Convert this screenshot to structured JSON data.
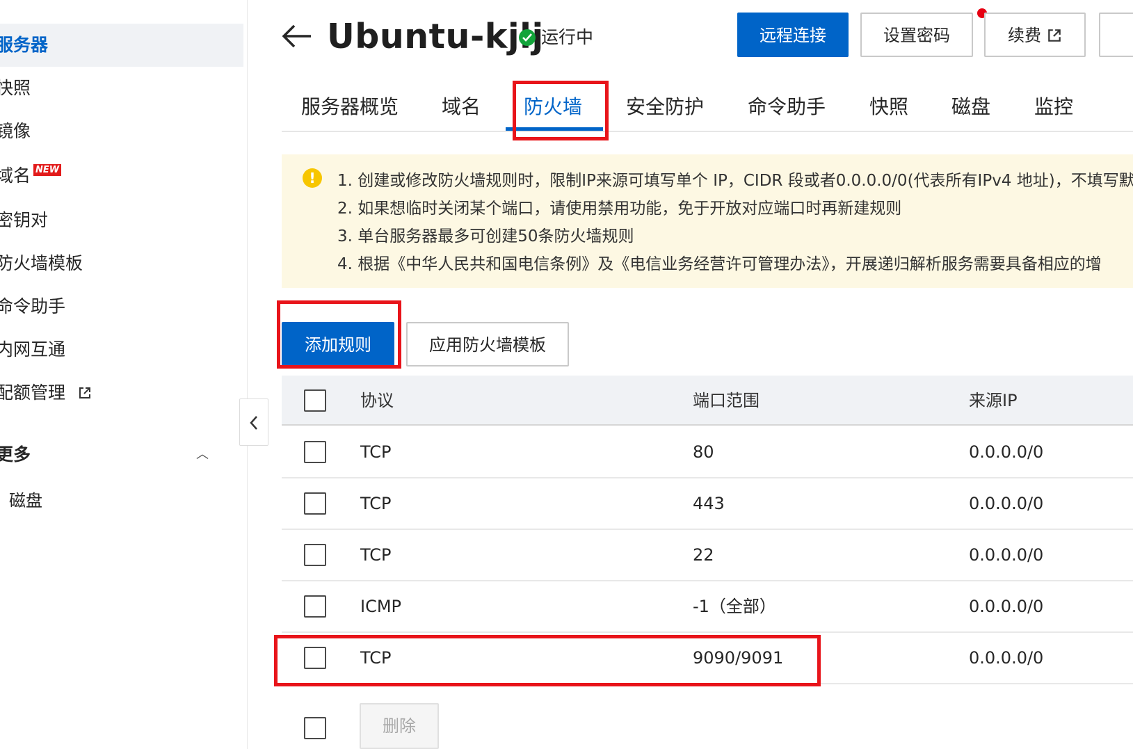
{
  "sidebar": {
    "items": [
      {
        "label": "服务器",
        "active": true
      },
      {
        "label": "快照"
      },
      {
        "label": "镜像"
      },
      {
        "label": "域名",
        "badge": "NEW"
      },
      {
        "label": "密钥对"
      },
      {
        "label": "防火墙模板"
      },
      {
        "label": "命令助手"
      },
      {
        "label": "内网互通"
      },
      {
        "label": "配额管理",
        "external": true
      }
    ],
    "group": {
      "label": "更多",
      "sub_items": [
        {
          "label": "磁盘"
        }
      ]
    }
  },
  "header": {
    "title": "Ubuntu-kjlj",
    "status": "运行中",
    "buttons": {
      "remote": "远程连接",
      "password": "设置密码",
      "renew": "续费"
    }
  },
  "tabs": [
    {
      "label": "服务器概览"
    },
    {
      "label": "域名"
    },
    {
      "label": "防火墙",
      "active": true
    },
    {
      "label": "安全防护"
    },
    {
      "label": "命令助手"
    },
    {
      "label": "快照"
    },
    {
      "label": "磁盘"
    },
    {
      "label": "监控"
    }
  ],
  "notice": {
    "lines": [
      "1. 创建或修改防火墙规则时，限制IP来源可填写单个 IP，CIDR 段或者0.0.0.0/0(代表所有IPv4 地址)，不填写默",
      "2. 如果想临时关闭某个端口，请使用禁用功能，免于开放对应端口时再新建规则",
      "3. 单台服务器最多可创建50条防火墙规则",
      "4. 根据《中华人民共和国电信条例》及《电信业务经营许可管理办法》，开展递归解析服务需要具备相应的增"
    ]
  },
  "actions": {
    "add_rule": "添加规则",
    "apply_template": "应用防火墙模板",
    "delete": "删除"
  },
  "table": {
    "headers": {
      "protocol": "协议",
      "port": "端口范围",
      "source": "来源IP"
    },
    "rows": [
      {
        "protocol": "TCP",
        "port": "80",
        "source": "0.0.0.0/0"
      },
      {
        "protocol": "TCP",
        "port": "443",
        "source": "0.0.0.0/0"
      },
      {
        "protocol": "TCP",
        "port": "22",
        "source": "0.0.0.0/0"
      },
      {
        "protocol": "ICMP",
        "port": "-1（全部）",
        "source": "0.0.0.0/0"
      },
      {
        "protocol": "TCP",
        "port": "9090/9091",
        "source": "0.0.0.0/0"
      }
    ]
  },
  "colors": {
    "primary": "#0064c8",
    "highlight": "#e8141a",
    "status_ok": "#12a43a",
    "notice_bg": "#fdf8e3"
  }
}
